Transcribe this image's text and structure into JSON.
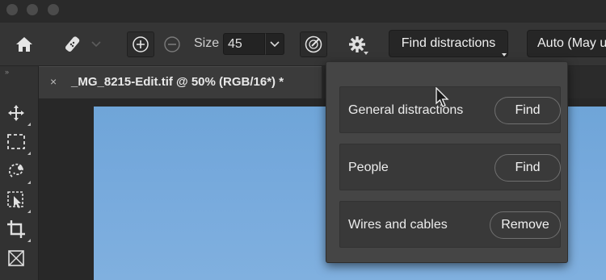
{
  "options_bar": {
    "size_label": "Size",
    "size_value": "45",
    "find_distractions_label": "Find distractions",
    "auto_label": "Auto (May u"
  },
  "document_tab": {
    "close_glyph": "×",
    "title": "_MG_8215-Edit.tif @ 50% (RGB/16*) *"
  },
  "find_distractions_panel": {
    "rows": [
      {
        "label": "General distractions",
        "button": "Find"
      },
      {
        "label": "People",
        "button": "Find"
      },
      {
        "label": "Wires and cables",
        "button": "Remove"
      }
    ]
  },
  "colors": {
    "sky_top": "#6fa5d8",
    "sky_bottom": "#80b0df",
    "panel_bg": "#454545"
  },
  "icons": [
    "home-icon",
    "healing-brush-icon",
    "add-mode-icon",
    "subtract-mode-icon",
    "chevron-down-icon",
    "pressure-icon",
    "gear-icon",
    "move-tool-icon",
    "marquee-tool-icon",
    "lasso-tool-icon",
    "object-select-tool-icon",
    "crop-tool-icon",
    "frame-tool-icon",
    "pointer-cursor-icon"
  ]
}
